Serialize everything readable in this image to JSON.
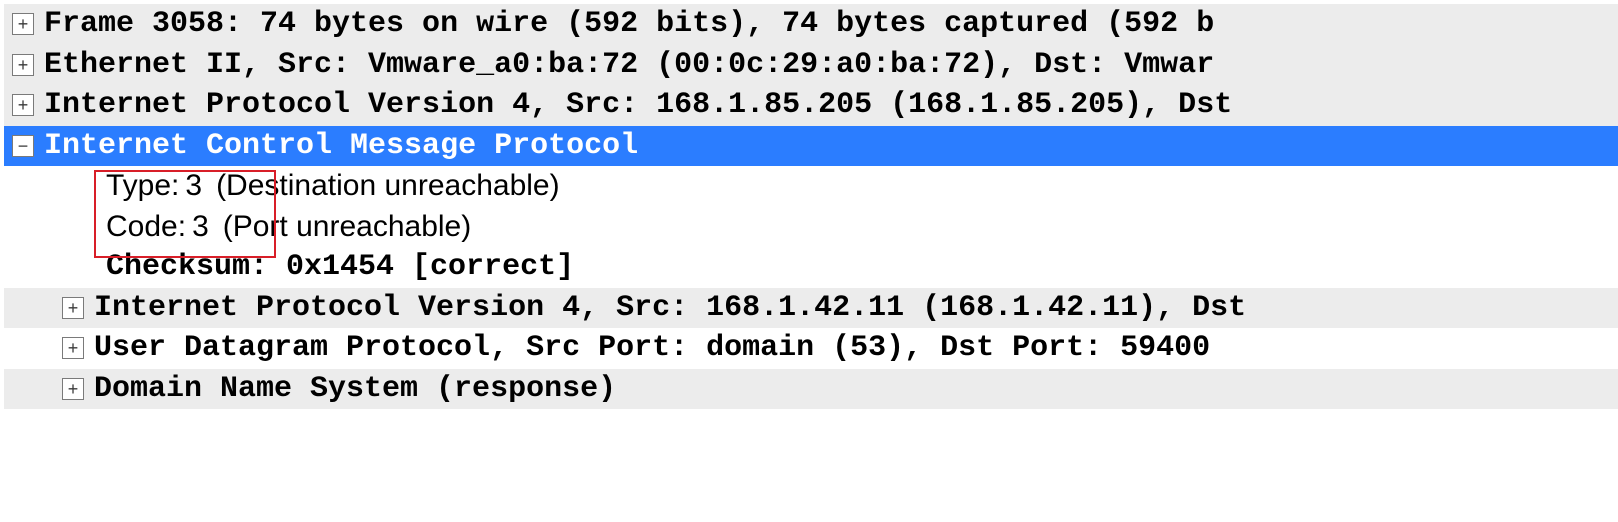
{
  "rows": {
    "frame": "Frame 3058: 74 bytes on wire (592 bits), 74 bytes captured (592 b",
    "ethernet": "Ethernet II, Src: Vmware_a0:ba:72 (00:0c:29:a0:ba:72), Dst: Vmwar",
    "ip_outer": "Internet Protocol Version 4, Src: 168.1.85.205 (168.1.85.205), Dst",
    "icmp_header": "Internet Control Message Protocol",
    "icmp": {
      "type_label": "Type: ",
      "type_value": "3",
      "type_desc": "(Destination unreachable)",
      "code_label": "Code: ",
      "code_value": "3",
      "code_desc": "(Port unreachable)",
      "checksum": "Checksum: 0x1454 [correct]"
    },
    "ip_inner": "Internet Protocol Version 4, Src: 168.1.42.11 (168.1.42.11), Dst",
    "udp": "User Datagram Protocol, Src Port: domain (53), Dst Port: 59400",
    "dns": "Domain Name System (response)"
  }
}
